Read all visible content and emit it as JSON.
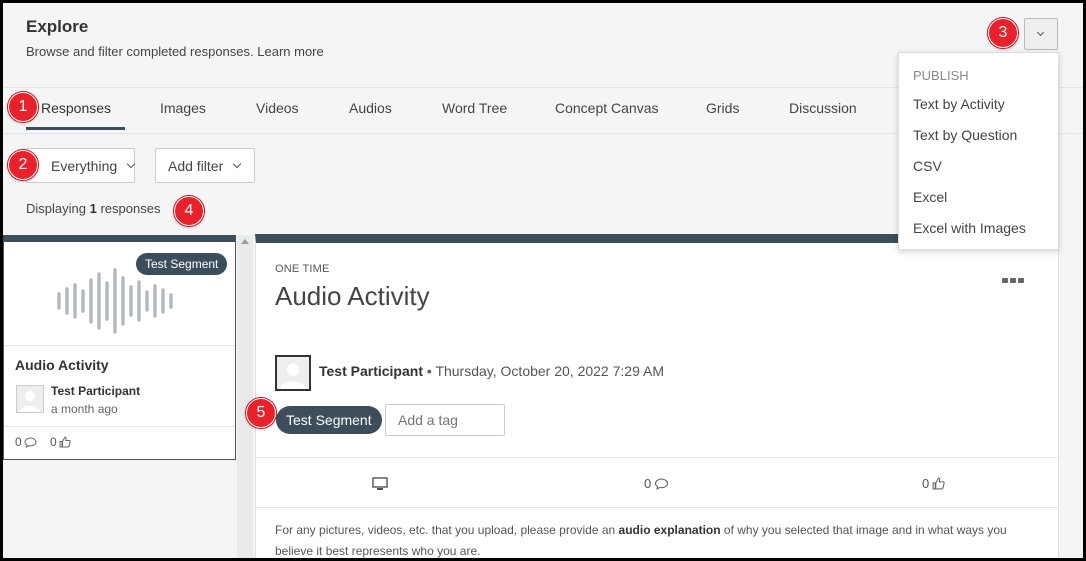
{
  "header": {
    "title": "Explore",
    "subtitle_text": "Browse and filter completed responses.",
    "learn_more": "Learn more"
  },
  "tabs": [
    {
      "label": "Responses",
      "active": true
    },
    {
      "label": "Images"
    },
    {
      "label": "Videos"
    },
    {
      "label": "Audios"
    },
    {
      "label": "Word Tree"
    },
    {
      "label": "Concept Canvas"
    },
    {
      "label": "Grids"
    },
    {
      "label": "Discussion"
    }
  ],
  "filters": {
    "scope_select": "Everything",
    "add_filter": "Add filter"
  },
  "summary": {
    "prefix": "Displaying",
    "count": "1",
    "suffix": "responses"
  },
  "response_card": {
    "segment_badge": "Test Segment",
    "title": "Audio Activity",
    "participant": "Test Participant",
    "time": "a month ago",
    "comments": "0",
    "likes": "0"
  },
  "detail": {
    "kind": "ONE TIME",
    "title": "Audio Activity",
    "participant": "Test Participant",
    "separator": "•",
    "datetime": "Thursday, October 20, 2022 7:29 AM",
    "segment_tag": "Test Segment",
    "tag_placeholder": "Add a tag",
    "comments": "0",
    "likes": "0",
    "desc_before": "For any pictures, videos, etc. that you upload, please provide an",
    "desc_bold": "audio explanation",
    "desc_after": "of why you selected that image and in what ways you believe it best represents who you are."
  },
  "publish_menu": {
    "header": "PUBLISH",
    "items": [
      "Text by Activity",
      "Text by Question",
      "CSV",
      "Excel",
      "Excel with Images"
    ]
  },
  "markers": [
    "1",
    "2",
    "3",
    "4",
    "5"
  ],
  "colors": {
    "accent_dark": "#3c4e5c",
    "marker_red": "#e8212b",
    "page_bg": "#f4f5f7"
  }
}
